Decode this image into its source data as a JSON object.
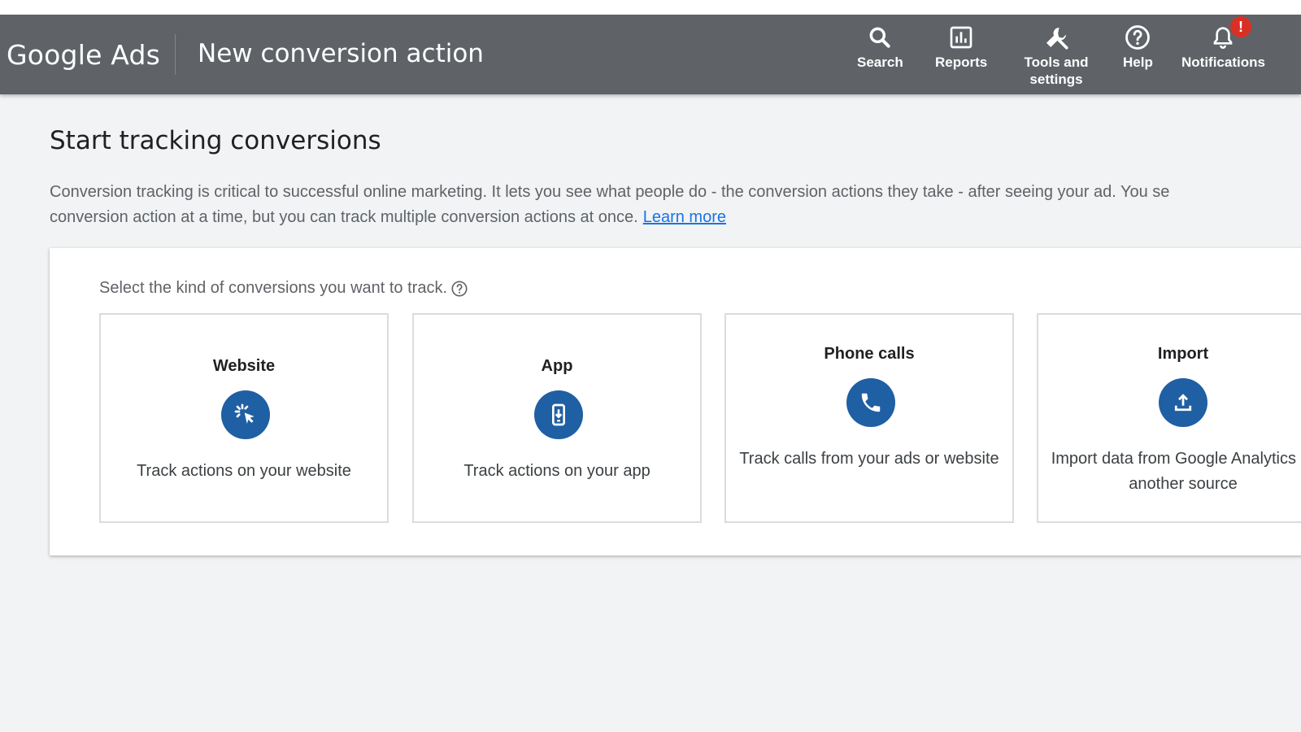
{
  "header": {
    "logo": "Google Ads",
    "title": "New conversion action",
    "nav": [
      {
        "label": "Search",
        "icon": "search-icon"
      },
      {
        "label": "Reports",
        "icon": "reports-icon"
      },
      {
        "label": "Tools and settings",
        "icon": "wrench-icon"
      },
      {
        "label": "Help",
        "icon": "help-icon"
      },
      {
        "label": "Notifications",
        "icon": "bell-icon"
      }
    ],
    "notification_badge": "!"
  },
  "main": {
    "title": "Start tracking conversions",
    "description_line1": "Conversion tracking is critical to successful online marketing. It lets you see what people do - the conversion actions they take - after seeing your ad. You se",
    "description_line2": "conversion action at a time, but you can track multiple conversion actions at once.",
    "learn_more": "Learn more",
    "prompt": "Select the kind of conversions you want to track.",
    "cards": [
      {
        "title": "Website",
        "description": "Track actions on your website",
        "icon": "cursor-click-icon"
      },
      {
        "title": "App",
        "description": "Track actions on your app",
        "icon": "phone-download-icon"
      },
      {
        "title": "Phone calls",
        "description": "Track calls from your ads or website",
        "icon": "phone-call-icon"
      },
      {
        "title": "Import",
        "description": "Import data from Google Analytics or another source",
        "icon": "upload-icon"
      }
    ]
  },
  "colors": {
    "header_bg": "#5f6368",
    "page_bg": "#f1f3f4",
    "icon_circle": "#1f5fa3",
    "link": "#1a73e8",
    "badge": "#d93025"
  }
}
